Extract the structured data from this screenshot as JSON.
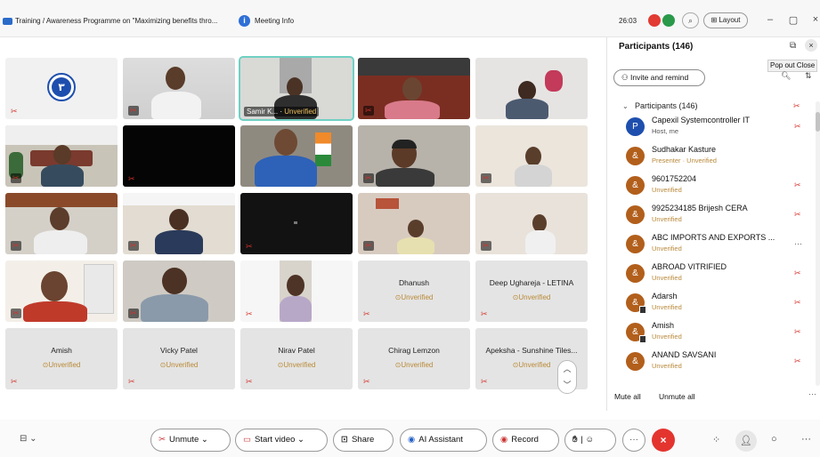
{
  "titlebar": {
    "app_title": "Training / Awareness Programme on \"Maximizing benefits thro...",
    "meeting_info": "Meeting Info",
    "timer": "26:03",
    "layout_label": "Layout",
    "minimize": "–",
    "maximize": "▢",
    "close": "×"
  },
  "grid": {
    "tiles": [
      {
        "type": "logo",
        "label": ""
      },
      {
        "type": "video"
      },
      {
        "type": "video",
        "caption_name": "Samir K...",
        "caption_status": "Unverified"
      },
      {
        "type": "video"
      },
      {
        "type": "video"
      },
      {
        "type": "video"
      },
      {
        "type": "video"
      },
      {
        "type": "video"
      },
      {
        "type": "video"
      },
      {
        "type": "video"
      },
      {
        "type": "video"
      },
      {
        "type": "video"
      },
      {
        "type": "video"
      },
      {
        "type": "video"
      },
      {
        "type": "video"
      },
      {
        "type": "video"
      },
      {
        "type": "video"
      },
      {
        "type": "video"
      },
      {
        "type": "name",
        "name": "Dhanush",
        "status": "Unverified"
      },
      {
        "type": "name",
        "name": "Deep Ughareja - LETINA",
        "status": "Unverified"
      },
      {
        "type": "name",
        "name": "Amish",
        "status": "Unverified"
      },
      {
        "type": "name",
        "name": "Vicky Patel",
        "status": "Unverified"
      },
      {
        "type": "name",
        "name": "Nirav Patel",
        "status": "Unverified"
      },
      {
        "type": "name",
        "name": "Chirag Lemzon",
        "status": "Unverified"
      },
      {
        "type": "name",
        "name": "Apeksha - Sunshine Tiles...",
        "status": "Unverified"
      }
    ]
  },
  "panel": {
    "title": "Participants (146)",
    "tooltip": "Pop out  Close",
    "invite_label": "Invite and remind",
    "section_label": "Participants (146)",
    "participants": [
      {
        "initial": "P",
        "name": "Capexil Systemcontroller IT",
        "sub": "Host, me",
        "host": true
      },
      {
        "initial": "&",
        "name": "Sudhakar Kasture",
        "sub": "Presenter · Unverified"
      },
      {
        "initial": "&",
        "name": "9601752204",
        "sub": "Unverified"
      },
      {
        "initial": "&",
        "name": "9925234185 Brijesh CERA",
        "sub": "Unverified"
      },
      {
        "initial": "&",
        "name": "ABC IMPORTS AND EXPORTS ...",
        "sub": "Unverified"
      },
      {
        "initial": "&",
        "name": "ABROAD VITRIFIED",
        "sub": "Unverified"
      },
      {
        "initial": "&",
        "name": "Adarsh",
        "sub": "Unverified"
      },
      {
        "initial": "&",
        "name": "Amish",
        "sub": "Unverified"
      },
      {
        "initial": "&",
        "name": "ANAND SAVSANI",
        "sub": "Unverified"
      }
    ],
    "mute_all": "Mute all",
    "unmute_all": "Unmute all"
  },
  "toolbar": {
    "unmute": "Unmute",
    "start_video": "Start video",
    "share": "Share",
    "ai_assistant": "AI Assistant",
    "record": "Record"
  },
  "colors": {
    "accent_blue": "#2f6fd6",
    "end_red": "#e4342e",
    "unverified_gold": "#b9893a",
    "avatar_brown": "#b25f1c",
    "active_tile_outline": "#6fd0c4"
  }
}
